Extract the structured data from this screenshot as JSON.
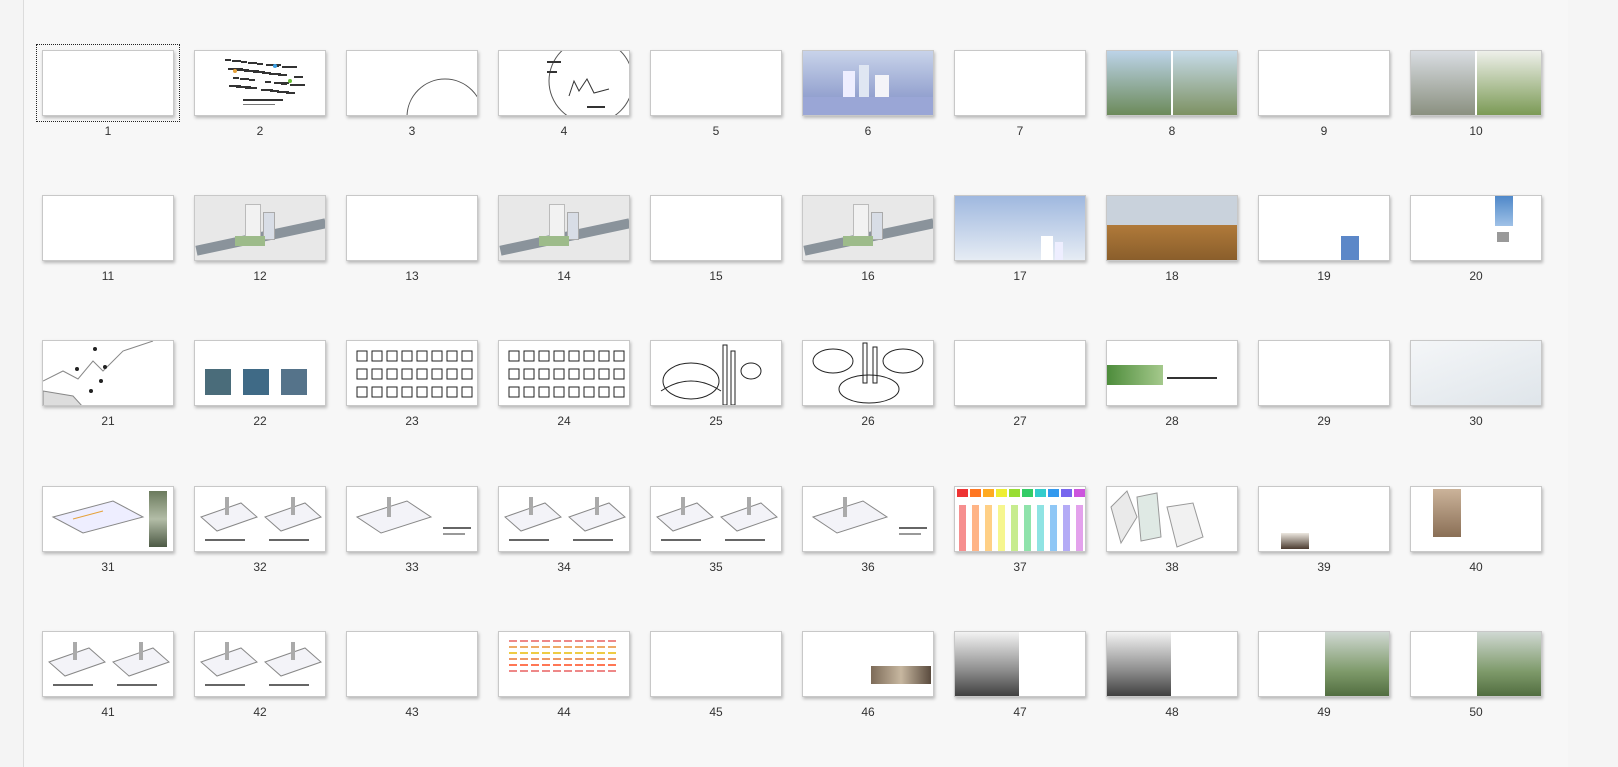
{
  "window": {
    "view": "slide-sorter"
  },
  "slides": [
    {
      "number": "1",
      "thumb": "blank",
      "selected": true
    },
    {
      "number": "2",
      "thumb": "mindmap"
    },
    {
      "number": "3",
      "thumb": "arc"
    },
    {
      "number": "4",
      "thumb": "circle-diagram"
    },
    {
      "number": "5",
      "thumb": "blank"
    },
    {
      "number": "6",
      "thumb": "winter-render"
    },
    {
      "number": "7",
      "thumb": "blank"
    },
    {
      "number": "8",
      "thumb": "two-renders"
    },
    {
      "number": "9",
      "thumb": "blank"
    },
    {
      "number": "10",
      "thumb": "two-renders-b"
    },
    {
      "number": "11",
      "thumb": "blank"
    },
    {
      "number": "12",
      "thumb": "aerial-model"
    },
    {
      "number": "13",
      "thumb": "blank"
    },
    {
      "number": "14",
      "thumb": "aerial-model"
    },
    {
      "number": "15",
      "thumb": "blank"
    },
    {
      "number": "16",
      "thumb": "aerial-model"
    },
    {
      "number": "17",
      "thumb": "sky-render"
    },
    {
      "number": "18",
      "thumb": "field-render"
    },
    {
      "number": "19",
      "thumb": "blue-box"
    },
    {
      "number": "20",
      "thumb": "tall-image"
    },
    {
      "number": "21",
      "thumb": "map"
    },
    {
      "number": "22",
      "thumb": "three-maps"
    },
    {
      "number": "23",
      "thumb": "icon-grid"
    },
    {
      "number": "24",
      "thumb": "icon-grid"
    },
    {
      "number": "25",
      "thumb": "line-sketch"
    },
    {
      "number": "26",
      "thumb": "line-sketch-2"
    },
    {
      "number": "27",
      "thumb": "blank"
    },
    {
      "number": "28",
      "thumb": "strip"
    },
    {
      "number": "29",
      "thumb": "blank"
    },
    {
      "number": "30",
      "thumb": "soft-gradient"
    },
    {
      "number": "31",
      "thumb": "axon-photos"
    },
    {
      "number": "32",
      "thumb": "axon-pair"
    },
    {
      "number": "33",
      "thumb": "axon-single"
    },
    {
      "number": "34",
      "thumb": "axon-pair"
    },
    {
      "number": "35",
      "thumb": "axon-pair"
    },
    {
      "number": "36",
      "thumb": "axon-single"
    },
    {
      "number": "37",
      "thumb": "rainbow"
    },
    {
      "number": "38",
      "thumb": "facades"
    },
    {
      "number": "39",
      "thumb": "small-photo"
    },
    {
      "number": "40",
      "thumb": "photo-corner"
    },
    {
      "number": "41",
      "thumb": "axon-pair"
    },
    {
      "number": "42",
      "thumb": "axon-pair"
    },
    {
      "number": "43",
      "thumb": "blank"
    },
    {
      "number": "44",
      "thumb": "table"
    },
    {
      "number": "45",
      "thumb": "blank"
    },
    {
      "number": "46",
      "thumb": "photo-bottom"
    },
    {
      "number": "47",
      "thumb": "interior-left"
    },
    {
      "number": "48",
      "thumb": "interior-left"
    },
    {
      "number": "49",
      "thumb": "render-right"
    },
    {
      "number": "50",
      "thumb": "render-right"
    }
  ],
  "colors": {
    "selection_outline": "#222222",
    "thumb_border": "#c8c8c8",
    "background": "#f7f7f7"
  }
}
